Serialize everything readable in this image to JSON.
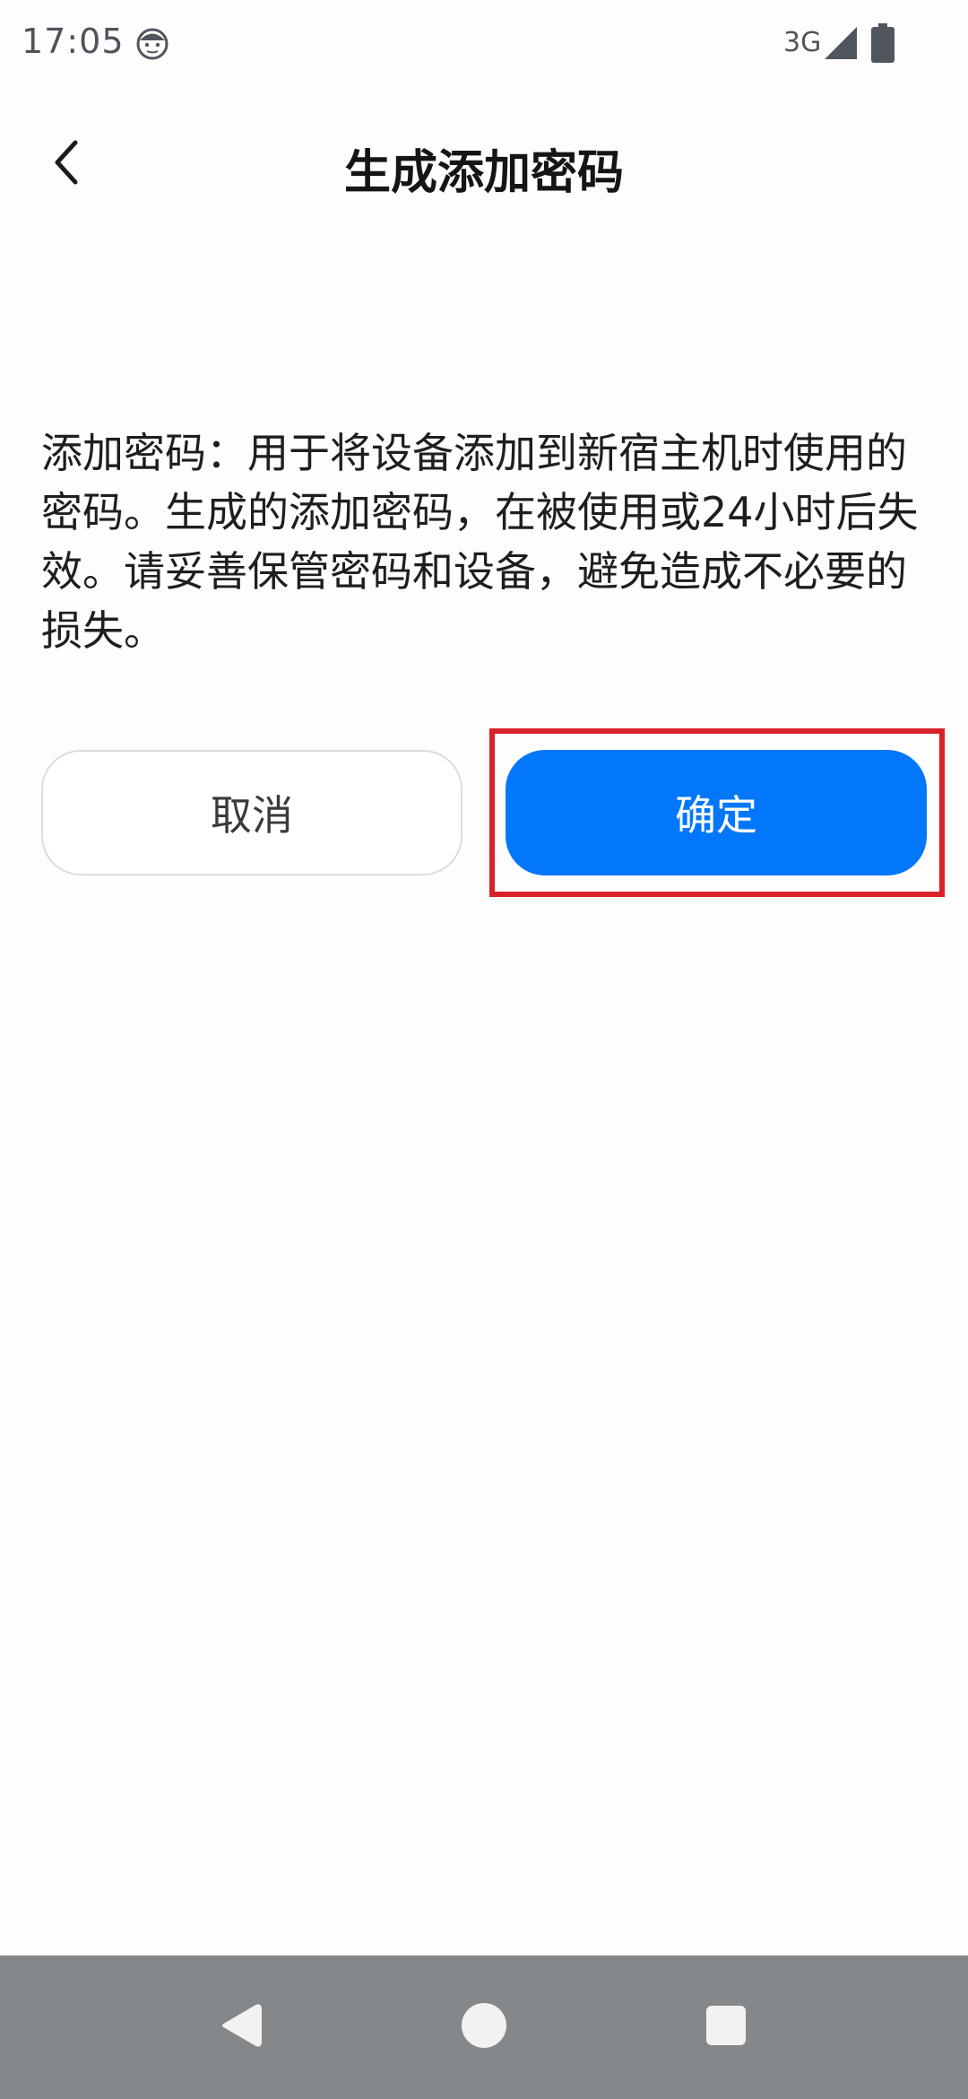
{
  "status_bar": {
    "time": "17:05",
    "network": "3G",
    "icons": [
      "face-notification-icon",
      "signal-icon",
      "battery-icon"
    ]
  },
  "header": {
    "title": "生成添加密码",
    "back_icon": "chevron-left-icon"
  },
  "content": {
    "description": "添加密码：用于将设备添加到新宿主机时使用的密码。生成的添加密码，在被使用或24小时后失效。请妥善保管密码和设备，避免造成不必要的损失。"
  },
  "actions": {
    "cancel_label": "取消",
    "confirm_label": "确定"
  },
  "nav_bar": {
    "icons": [
      "nav-back-icon",
      "nav-home-icon",
      "nav-recents-icon"
    ]
  },
  "colors": {
    "accent": "#0277fa",
    "highlight": "#d8222a",
    "nav_bar": "#85888b"
  }
}
